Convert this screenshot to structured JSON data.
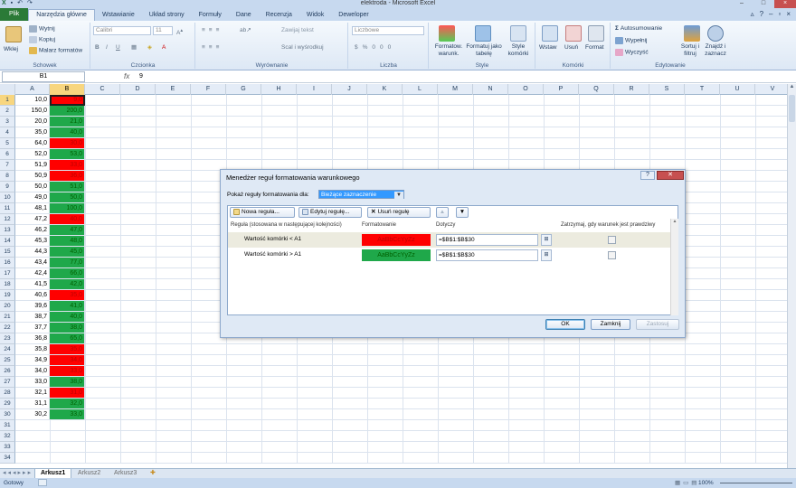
{
  "title": "elektroda - Microsoft Excel",
  "tabs": [
    "Plik",
    "Narzędzia główne",
    "Wstawianie",
    "Układ strony",
    "Formuły",
    "Dane",
    "Recenzja",
    "Widok",
    "Deweloper"
  ],
  "ribbon": {
    "groups": [
      "Schowek",
      "Czcionka",
      "Wyrównanie",
      "Liczba",
      "Style",
      "Komórki",
      "Edytowanie"
    ],
    "paste": "Wklej",
    "cut": "Wytnij",
    "copy": "Kopiuj",
    "format_painter": "Malarz formatów",
    "font": "Calibri",
    "size": "11",
    "wrap": "Zawijaj tekst",
    "merge": "Scal i wyśrodkuj",
    "number_format": "Liczbowe",
    "cond_format": "Formatow. warunk.",
    "format_table": "Formatuj jako tabelę",
    "cell_styles": "Style komórki",
    "insert": "Wstaw",
    "delete": "Usuń",
    "format": "Format",
    "autosum": "Autosumowanie",
    "fill": "Wypełnij",
    "clear": "Wyczyść",
    "sort": "Sortuj i filtruj",
    "find": "Znajdź i zaznacz"
  },
  "formula_bar": {
    "cell": "B1",
    "fx": "fx",
    "value": "9"
  },
  "columns": [
    "A",
    "B",
    "C",
    "D",
    "E",
    "F",
    "G",
    "H",
    "I",
    "J",
    "K",
    "L",
    "M",
    "N",
    "O",
    "P",
    "Q",
    "R",
    "S",
    "T",
    "U",
    "V"
  ],
  "rows": [
    {
      "a": "10,0",
      "b": "9,0",
      "c": "red"
    },
    {
      "a": "150,0",
      "b": "200,0",
      "c": "green"
    },
    {
      "a": "20,0",
      "b": "21,0",
      "c": "green"
    },
    {
      "a": "35,0",
      "b": "40,0",
      "c": "green"
    },
    {
      "a": "64,0",
      "b": "30,0",
      "c": "red"
    },
    {
      "a": "52,0",
      "b": "53,0",
      "c": "green"
    },
    {
      "a": "51,9",
      "b": "33,0",
      "c": "red"
    },
    {
      "a": "50,9",
      "b": "36,0",
      "c": "red"
    },
    {
      "a": "50,0",
      "b": "51,0",
      "c": "green"
    },
    {
      "a": "49,0",
      "b": "50,0",
      "c": "green"
    },
    {
      "a": "48,1",
      "b": "100,0",
      "c": "green"
    },
    {
      "a": "47,2",
      "b": "40,0",
      "c": "red"
    },
    {
      "a": "46,2",
      "b": "47,0",
      "c": "green"
    },
    {
      "a": "45,3",
      "b": "48,0",
      "c": "green"
    },
    {
      "a": "44,3",
      "b": "45,0",
      "c": "green"
    },
    {
      "a": "43,4",
      "b": "77,0",
      "c": "green"
    },
    {
      "a": "42,4",
      "b": "66,0",
      "c": "green"
    },
    {
      "a": "41,5",
      "b": "42,0",
      "c": "green"
    },
    {
      "a": "40,6",
      "b": "35,0",
      "c": "red"
    },
    {
      "a": "39,6",
      "b": "41,0",
      "c": "green"
    },
    {
      "a": "38,7",
      "b": "40,0",
      "c": "green"
    },
    {
      "a": "37,7",
      "b": "38,0",
      "c": "green"
    },
    {
      "a": "36,8",
      "b": "65,0",
      "c": "green"
    },
    {
      "a": "35,8",
      "b": "35,0",
      "c": "red"
    },
    {
      "a": "34,9",
      "b": "34,0",
      "c": "red"
    },
    {
      "a": "34,0",
      "b": "33,0",
      "c": "red"
    },
    {
      "a": "33,0",
      "b": "38,0",
      "c": "green"
    },
    {
      "a": "32,1",
      "b": "31,0",
      "c": "red"
    },
    {
      "a": "31,1",
      "b": "32,0",
      "c": "green"
    },
    {
      "a": "30,2",
      "b": "33,0",
      "c": "green"
    }
  ],
  "row_count": 34,
  "sheets": [
    "Arkusz1",
    "Arkusz2",
    "Arkusz3"
  ],
  "status": "Gotowy",
  "zoom": "100%",
  "dialog": {
    "title": "Menedżer reguł formatowania warunkowego",
    "show_label": "Pokaż reguły formatowania dla:",
    "show_value": "Bieżące zaznaczenie",
    "new_rule": "Nowa reguła...",
    "edit_rule": "Edytuj regułę...",
    "delete_rule": "Usuń regułę",
    "col_rule": "Reguła (stosowana w następującej kolejności)",
    "col_format": "Formatowanie",
    "col_applies": "Dotyczy",
    "col_stop": "Zatrzymaj, gdy warunek jest prawdziwy",
    "rules": [
      {
        "name": "Wartość komórki < A1",
        "preview": "AaBbCcYyZz",
        "applies": "=$B$1:$B$30",
        "color": "red"
      },
      {
        "name": "Wartość komórki > A1",
        "preview": "AaBbCcYyZz",
        "applies": "=$B$1:$B$30",
        "color": "green"
      }
    ],
    "ok": "OK",
    "close": "Zamknij",
    "apply": "Zastosuj"
  },
  "colors": {
    "red_fill": "#ff0000",
    "green_fill": "#1fa84a",
    "file_tab": "#2a7a37"
  }
}
